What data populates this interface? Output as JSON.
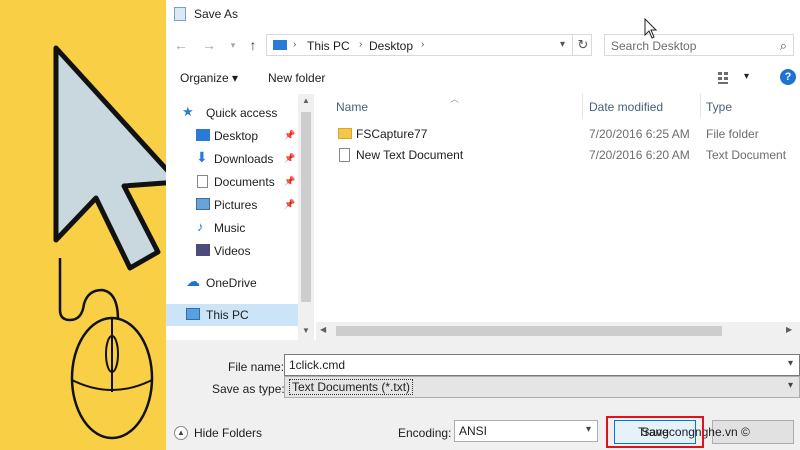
{
  "dialog": {
    "title": "Save As",
    "address": {
      "crumbs": [
        "This PC",
        "Desktop"
      ],
      "search_placeholder": "Search Desktop"
    },
    "toolbar": {
      "organize": "Organize ▾",
      "new_folder": "New folder"
    },
    "nav": [
      {
        "label": "Quick access",
        "icon": "star-icon",
        "pinned": false
      },
      {
        "label": "Desktop",
        "icon": "desktop-icon",
        "pinned": true
      },
      {
        "label": "Downloads",
        "icon": "download-icon",
        "pinned": true
      },
      {
        "label": "Documents",
        "icon": "documents-icon",
        "pinned": true
      },
      {
        "label": "Pictures",
        "icon": "pictures-icon",
        "pinned": true
      },
      {
        "label": "Music",
        "icon": "music-icon",
        "pinned": false
      },
      {
        "label": "Videos",
        "icon": "videos-icon",
        "pinned": false
      },
      {
        "label": "OneDrive",
        "icon": "cloud-icon",
        "pinned": false
      },
      {
        "label": "This PC",
        "icon": "computer-icon",
        "pinned": false,
        "selected": true
      }
    ],
    "columns": {
      "name": "Name",
      "date": "Date modified",
      "type": "Type"
    },
    "files": [
      {
        "name": "FSCapture77",
        "date": "7/20/2016 6:25 AM",
        "type": "File folder",
        "icon": "folder-icon"
      },
      {
        "name": "New Text Document",
        "date": "7/20/2016 6:20 AM",
        "type": "Text Document",
        "icon": "text-file-icon"
      }
    ],
    "file_name_label": "File name:",
    "file_name_value": "1click.cmd",
    "save_type_label": "Save as type:",
    "save_type_value": "Text Documents (*.txt)",
    "encoding_label": "Encoding:",
    "encoding_value": "ANSI",
    "hide_folders": "Hide Folders",
    "save_button": "Save",
    "watermark": "Trangcongnghe.vn ©"
  },
  "colors": {
    "left_panel": "#f9cf45",
    "highlight_border": "#e0121b",
    "selection": "#cce4f7",
    "accent": "#1e73d2"
  }
}
